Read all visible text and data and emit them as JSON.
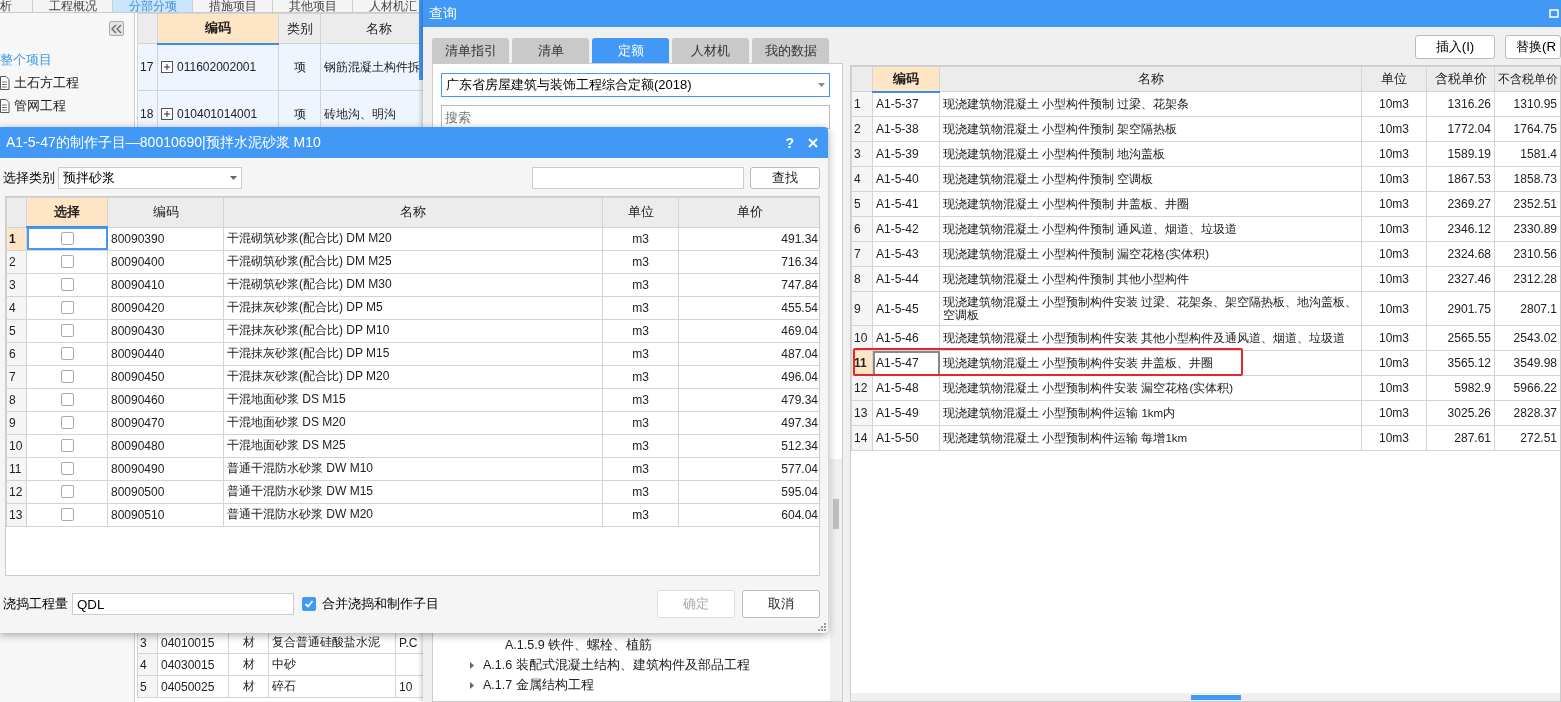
{
  "background_app": {
    "tabs": [
      {
        "label": "析",
        "selected": false
      },
      {
        "label": "工程概况",
        "selected": false
      },
      {
        "label": "分部分项",
        "selected": true
      },
      {
        "label": "措施项目",
        "selected": false
      },
      {
        "label": "其他项目",
        "selected": false
      },
      {
        "label": "人材机汇",
        "selected": false
      }
    ],
    "sidebar": {
      "items": [
        {
          "label": "整个项目",
          "selected": true,
          "children": [
            {
              "label": "土石方工程",
              "selected": false
            },
            {
              "label": "管网工程",
              "selected": false
            }
          ]
        }
      ]
    },
    "table": {
      "columns": [
        "编码",
        "类别",
        "名称"
      ],
      "rows": [
        {
          "number": "17",
          "code": "011602002001",
          "type": "项",
          "name": "钢筋混凝土构件拆"
        },
        {
          "number": "18",
          "code": "010401014001",
          "type": "项",
          "name": "砖地沟、明沟"
        }
      ]
    },
    "lower_table": {
      "rows": [
        {
          "number": "3",
          "code": "04010015",
          "type": "材",
          "name": "复合普通硅酸盐水泥",
          "column_5": "P.C"
        },
        {
          "number": "4",
          "code": "04030015",
          "type": "材",
          "name": "中砂",
          "column_5": ""
        },
        {
          "number": "5",
          "code": "04050025",
          "type": "材",
          "name": "碎石",
          "column_5": "10"
        }
      ]
    }
  },
  "query_window": {
    "title": "查询",
    "tabs": [
      {
        "label": "清单指引",
        "selected": false
      },
      {
        "label": "清单",
        "selected": false
      },
      {
        "label": "定额",
        "selected": true
      },
      {
        "label": "人材机",
        "selected": false
      },
      {
        "label": "我的数据",
        "selected": false
      }
    ],
    "library_select": "广东省房屋建筑与装饰工程综合定额(2018)",
    "search": {
      "placeholder": "搜索"
    },
    "tree": {
      "items": [
        {
          "label": "A.1.5.9 铁件、螺栓、植筋",
          "kind": "leaf"
        },
        {
          "label": "A.1.6 装配式混凝土结构、建筑构件及部品工程",
          "kind": "branch",
          "expanded": false
        },
        {
          "label": "A.1.7 金属结构工程",
          "kind": "branch",
          "expanded": false
        }
      ]
    },
    "buttons": [
      "插入(I)",
      "替换(R"
    ],
    "table": {
      "columns": [
        "编码",
        "名称",
        "单位",
        "含税单价",
        "不含税单价"
      ],
      "rows": [
        {
          "number": "1",
          "code": "A1-5-37",
          "name": "现浇建筑物混凝土 小型构件预制 过梁、花架条",
          "unit": "10m3",
          "price_with_tax": "1316.26",
          "price_without_tax": "1310.95",
          "selected": false,
          "highlighted": false
        },
        {
          "number": "2",
          "code": "A1-5-38",
          "name": "现浇建筑物混凝土 小型构件预制 架空隔热板",
          "unit": "10m3",
          "price_with_tax": "1772.04",
          "price_without_tax": "1764.75",
          "selected": false,
          "highlighted": false
        },
        {
          "number": "3",
          "code": "A1-5-39",
          "name": "现浇建筑物混凝土 小型构件预制 地沟盖板",
          "unit": "10m3",
          "price_with_tax": "1589.19",
          "price_without_tax": "1581.4",
          "selected": false,
          "highlighted": false
        },
        {
          "number": "4",
          "code": "A1-5-40",
          "name": "现浇建筑物混凝土 小型构件预制 空调板",
          "unit": "10m3",
          "price_with_tax": "1867.53",
          "price_without_tax": "1858.73",
          "selected": false,
          "highlighted": false
        },
        {
          "number": "5",
          "code": "A1-5-41",
          "name": "现浇建筑物混凝土 小型构件预制 井盖板、井圈",
          "unit": "10m3",
          "price_with_tax": "2369.27",
          "price_without_tax": "2352.51",
          "selected": false,
          "highlighted": false
        },
        {
          "number": "6",
          "code": "A1-5-42",
          "name": "现浇建筑物混凝土 小型构件预制 通风道、烟道、垃圾道",
          "unit": "10m3",
          "price_with_tax": "2346.12",
          "price_without_tax": "2330.89",
          "selected": false,
          "highlighted": false
        },
        {
          "number": "7",
          "code": "A1-5-43",
          "name": "现浇建筑物混凝土 小型构件预制 漏空花格(实体积)",
          "unit": "10m3",
          "price_with_tax": "2324.68",
          "price_without_tax": "2310.56",
          "selected": false,
          "highlighted": false
        },
        {
          "number": "8",
          "code": "A1-5-44",
          "name": "现浇建筑物混凝土 小型构件预制 其他小型构件",
          "unit": "10m3",
          "price_with_tax": "2327.46",
          "price_without_tax": "2312.28",
          "selected": false,
          "highlighted": false
        },
        {
          "number": "9",
          "code": "A1-5-45",
          "name": "现浇建筑物混凝土 小型预制构件安装 过梁、花架条、架空隔热板、地沟盖板、空调板",
          "unit": "10m3",
          "price_with_tax": "2901.75",
          "price_without_tax": "2807.1",
          "selected": false,
          "highlighted": false
        },
        {
          "number": "10",
          "code": "A1-5-46",
          "name": "现浇建筑物混凝土 小型预制构件安装 其他小型构件及通风道、烟道、垃圾道",
          "unit": "10m3",
          "price_with_tax": "2565.55",
          "price_without_tax": "2543.02",
          "selected": false,
          "highlighted": false
        },
        {
          "number": "11",
          "code": "A1-5-47",
          "name": "现浇建筑物混凝土 小型预制构件安装 井盖板、井圈",
          "unit": "10m3",
          "price_with_tax": "3565.12",
          "price_without_tax": "3549.98",
          "selected": true,
          "highlighted": true
        },
        {
          "number": "12",
          "code": "A1-5-48",
          "name": "现浇建筑物混凝土 小型预制构件安装 漏空花格(实体积)",
          "unit": "10m3",
          "price_with_tax": "5982.9",
          "price_without_tax": "5966.22",
          "selected": false,
          "highlighted": false
        },
        {
          "number": "13",
          "code": "A1-5-49",
          "name": "现浇建筑物混凝土 小型预制构件运输 1km内",
          "unit": "10m3",
          "price_with_tax": "3025.26",
          "price_without_tax": "2828.37",
          "selected": false,
          "highlighted": false
        },
        {
          "number": "14",
          "code": "A1-5-50",
          "name": "现浇建筑物混凝土 小型预制构件运输 每增1km",
          "unit": "10m3",
          "price_with_tax": "287.61",
          "price_without_tax": "272.51",
          "selected": false,
          "highlighted": false
        }
      ]
    }
  },
  "dialog": {
    "title": "A1-5-47的制作子目—80010690|预拌水泥砂浆 M10",
    "help": "?",
    "category_label": "选择类别",
    "category_select": "预拌砂浆",
    "find_button": "查找",
    "table": {
      "columns": [
        "选择",
        "编码",
        "名称",
        "单位",
        "单价"
      ],
      "rows": [
        {
          "number": "1",
          "checked": false,
          "code": "80090390",
          "name": "干混砌筑砂浆(配合比) DM M20",
          "unit": "m3",
          "price": "491.34",
          "selected": true
        },
        {
          "number": "2",
          "checked": false,
          "code": "80090400",
          "name": "干混砌筑砂浆(配合比) DM M25",
          "unit": "m3",
          "price": "716.34",
          "selected": false
        },
        {
          "number": "3",
          "checked": false,
          "code": "80090410",
          "name": "干混砌筑砂浆(配合比) DM M30",
          "unit": "m3",
          "price": "747.84",
          "selected": false
        },
        {
          "number": "4",
          "checked": false,
          "code": "80090420",
          "name": "干混抹灰砂浆(配合比) DP M5",
          "unit": "m3",
          "price": "455.54",
          "selected": false
        },
        {
          "number": "5",
          "checked": false,
          "code": "80090430",
          "name": "干混抹灰砂浆(配合比) DP M10",
          "unit": "m3",
          "price": "469.04",
          "selected": false
        },
        {
          "number": "6",
          "checked": false,
          "code": "80090440",
          "name": "干混抹灰砂浆(配合比) DP M15",
          "unit": "m3",
          "price": "487.04",
          "selected": false
        },
        {
          "number": "7",
          "checked": false,
          "code": "80090450",
          "name": "干混抹灰砂浆(配合比) DP M20",
          "unit": "m3",
          "price": "496.04",
          "selected": false
        },
        {
          "number": "8",
          "checked": false,
          "code": "80090460",
          "name": "干混地面砂浆 DS M15",
          "unit": "m3",
          "price": "479.34",
          "selected": false
        },
        {
          "number": "9",
          "checked": false,
          "code": "80090470",
          "name": "干混地面砂浆 DS M20",
          "unit": "m3",
          "price": "497.34",
          "selected": false
        },
        {
          "number": "10",
          "checked": false,
          "code": "80090480",
          "name": "干混地面砂浆 DS M25",
          "unit": "m3",
          "price": "512.34",
          "selected": false
        },
        {
          "number": "11",
          "checked": false,
          "code": "80090490",
          "name": "普通干混防水砂浆 DW M10",
          "unit": "m3",
          "price": "577.04",
          "selected": false
        },
        {
          "number": "12",
          "checked": false,
          "code": "80090500",
          "name": "普通干混防水砂浆 DW M15",
          "unit": "m3",
          "price": "595.04",
          "selected": false
        },
        {
          "number": "13",
          "checked": false,
          "code": "80090510",
          "name": "普通干混防水砂浆 DW M20",
          "unit": "m3",
          "price": "604.04",
          "selected": false
        }
      ]
    },
    "quantity_label": "浇捣工程量",
    "quantity_value": "QDL",
    "merge_checkbox": {
      "label": "合并浇捣和制作子目",
      "checked": true
    },
    "buttons": [
      {
        "label": "确定",
        "disabled": true
      },
      {
        "label": "取消",
        "disabled": false
      }
    ]
  }
}
